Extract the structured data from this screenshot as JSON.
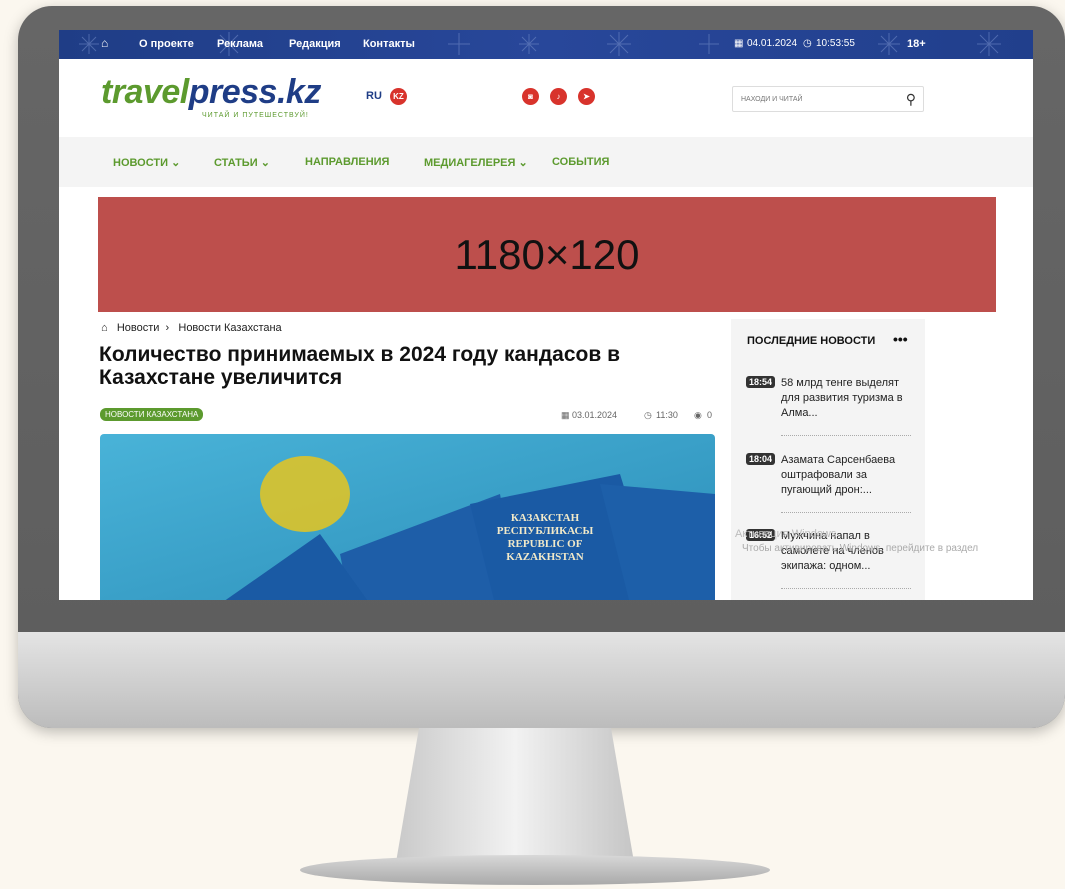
{
  "topbar": {
    "home_icon": "home-icon",
    "links": [
      "О проекте",
      "Реклама",
      "Редакция",
      "Контакты"
    ],
    "date": "04.01.2024",
    "time": "10:53:55",
    "age": "18+"
  },
  "header": {
    "logo_part1": "travel",
    "logo_part2": "press.kz",
    "slogan": "ЧИТАЙ И ПУТЕШЕСТВУЙ!",
    "lang_ru": "RU",
    "lang_kz": "KZ",
    "social_icons": [
      "instagram-icon",
      "tiktok-icon",
      "telegram-icon"
    ],
    "search_placeholder": "НАХОДИ И ЧИТАЙ"
  },
  "nav": {
    "items": [
      "НОВОСТИ",
      "СТАТЬИ",
      "НАПРАВЛЕНИЯ",
      "МЕДИАГЕЛЕРЕЯ",
      "СОБЫТИЯ"
    ]
  },
  "banner": {
    "text": "1180×120"
  },
  "article": {
    "breadcrumb": [
      "Новости",
      "Новости Казахстана"
    ],
    "title": "Количество принимаемых в 2024 году кандасов в Казахстане увеличится",
    "tag": "НОВОСТИ КАЗАХСТАНА",
    "date": "03.01.2024",
    "time": "11:30",
    "views": "0",
    "passport_text_1": "КАЗАКСТАН РЕСПУБЛИКАСЫ",
    "passport_text_2": "REPUBLIC OF KAZAKHSTAN"
  },
  "sidebar": {
    "title": "ПОСЛЕДНИЕ НОВОСТИ",
    "more": "•••",
    "items": [
      {
        "time": "18:54",
        "text": "58 млрд тенге выделят для развития туризма в Алма..."
      },
      {
        "time": "18:04",
        "text": "Азамата Сарсенбаева оштрафовали за пугающий дрон:..."
      },
      {
        "time": "16:52",
        "text": "Мужчина напал в самолете на членов экипажа: одном..."
      }
    ]
  },
  "watermark": {
    "line1": "Активация Windows",
    "line2": "Чтобы активировать Windows, перейдите в раздел"
  }
}
